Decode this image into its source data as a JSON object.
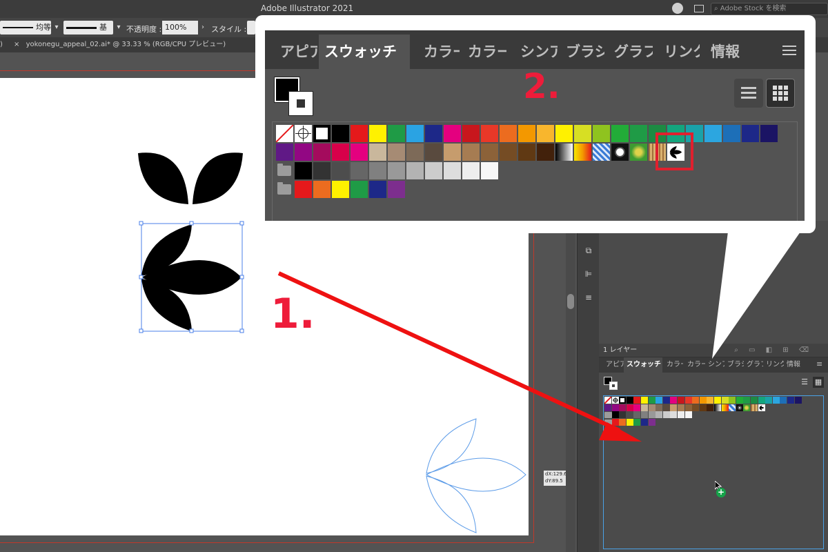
{
  "menubar": {
    "app_title": "Adobe Illustrator 2021",
    "stock_search_placeholder": "Adobe Stock を検索"
  },
  "control_bar": {
    "profile_label": "均等",
    "brush_label": "基本",
    "opacity_label": "不透明度 :",
    "opacity_value": "100%",
    "style_label": "スタイル :"
  },
  "document": {
    "tab_close": "×",
    "tab_title": "yokonegu_appeal_02.ai* @ 33.33 % (RGB/CPU プレビュー)",
    "left_fragment": ")"
  },
  "drag_tooltip": {
    "dx": "dX:129.6",
    "dy": "dY:89.5"
  },
  "layers": {
    "count_label": "1 レイヤー"
  },
  "swatches_panel": {
    "tabs": [
      "アピア",
      "スウォッチ",
      "カラー",
      "カラー",
      "シンア",
      "ブラシ",
      "グラフ",
      "リンク",
      "情報"
    ],
    "active_tab": "スウォッチ",
    "view_list": "list-view",
    "view_grid": "grid-view"
  },
  "callout": {
    "tabs": [
      "アピア",
      "スウォッチ",
      "カラー",
      "カラー",
      "シンア",
      "ブラシ",
      "グラフ",
      "リンク",
      "情報"
    ],
    "active_tab": "スウォッチ"
  },
  "steps": {
    "step1": "1.",
    "step2": "2."
  },
  "swatches": {
    "row1": [
      "none",
      "registration",
      "white",
      "#000000",
      "#e5191b",
      "#fff100",
      "#1f9b46",
      "#2aa3e3",
      "#1d2888",
      "#e4007f",
      "#c8161d",
      "#e83828",
      "#ec6c1f",
      "#f39800",
      "#f8b62d",
      "#fff100",
      "#d7df23",
      "#8fc31f",
      "#22ac38",
      "#1f9b46",
      "#1c8b43",
      "#13a67e",
      "#1aa2a9",
      "#2ca6e0",
      "#1d6fb8",
      "#1d2888",
      "#1b1464"
    ],
    "row2": [
      "#601986",
      "#920783",
      "#a40b5d",
      "#d7004a",
      "#e4007f",
      "#c9b79c",
      "#a68b74",
      "#7d6a58",
      "#594a3e",
      "#c69c6d",
      "#a67c52",
      "#8c6239",
      "#754c24",
      "#603913",
      "#42210b",
      "gradient-bw",
      "gradient-orange",
      "pattern-check",
      "pattern-dots",
      "pattern-green",
      "pattern-wood",
      "leaf-pattern"
    ],
    "row3": [
      "#000000",
      "#333333",
      "#4d4d4d",
      "#666666",
      "#808080",
      "#999999",
      "#b3b3b3",
      "#cccccc",
      "#dddddd",
      "#eeeeee",
      "#f7f7f7"
    ],
    "row4": [
      "#e5191b",
      "#ec6c1f",
      "#fff100",
      "#1f9b46",
      "#1d2888",
      "#7d2e8e"
    ]
  },
  "colors": {
    "accent_red": "#e0202e",
    "arrow_red": "#ee1111",
    "selection_blue": "#4a7fe8",
    "ghost_outline": "#5b9be8"
  },
  "icons": {
    "account": "account-icon",
    "workspace": "workspace-icon",
    "search": "search-icon",
    "panel_menu": "panel-menu-icon",
    "cursor": "cursor-icon",
    "add": "plus-icon",
    "folder": "folder-icon"
  }
}
